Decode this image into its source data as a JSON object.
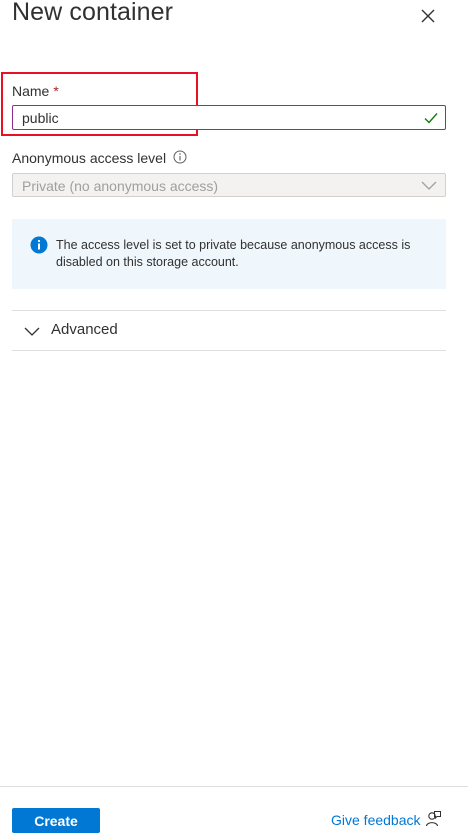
{
  "panel": {
    "title": "New container",
    "close_icon": "close-icon"
  },
  "name_field": {
    "label": "Name",
    "required_marker": "*",
    "value": "public",
    "valid_icon": "checkmark-icon"
  },
  "access_field": {
    "label": "Anonymous access level",
    "info_icon": "info-icon",
    "selected_value": "Private (no anonymous access)",
    "disabled": true
  },
  "info_banner": {
    "icon": "info-filled-icon",
    "message": "The access level is set to private because anonymous access is disabled on this storage account."
  },
  "advanced_section": {
    "label": "Advanced",
    "expanded": false
  },
  "footer": {
    "create_label": "Create",
    "feedback_label": "Give feedback",
    "feedback_icon": "feedback-icon"
  },
  "colors": {
    "primary": "#0078d4",
    "highlight_border": "#e81123",
    "required": "#a4262c",
    "valid_check": "#107c10",
    "info_bg": "#eff6fc"
  }
}
